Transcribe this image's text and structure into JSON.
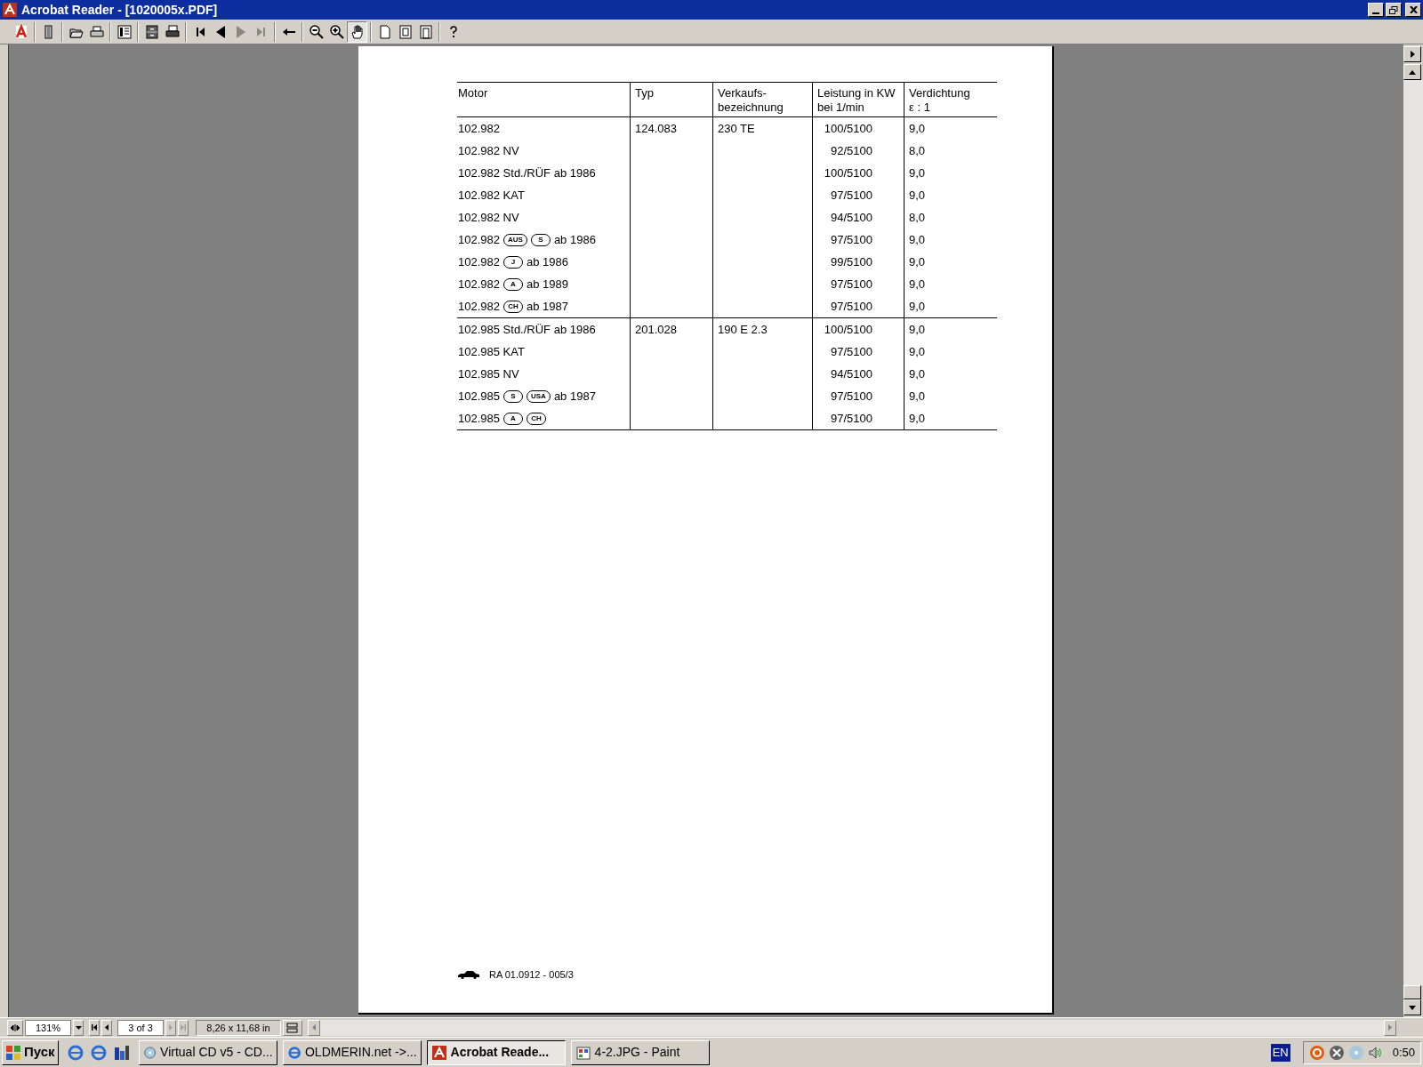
{
  "window": {
    "title": "Acrobat Reader - [1020005x.PDF]"
  },
  "toolbar": [
    {
      "kind": "acrobat",
      "selected": false,
      "disabled": false
    },
    {
      "kind": "sep"
    },
    {
      "kind": "pane",
      "selected": false,
      "disabled": false
    },
    {
      "kind": "sep"
    },
    {
      "kind": "open",
      "selected": false,
      "disabled": false
    },
    {
      "kind": "print",
      "selected": false,
      "disabled": false
    },
    {
      "kind": "sep"
    },
    {
      "kind": "thumbs",
      "selected": false,
      "disabled": false
    },
    {
      "kind": "sep"
    },
    {
      "kind": "cabinet",
      "selected": false,
      "disabled": false
    },
    {
      "kind": "printer2",
      "selected": false,
      "disabled": false
    },
    {
      "kind": "sep"
    },
    {
      "kind": "first",
      "selected": false,
      "disabled": false
    },
    {
      "kind": "prev",
      "selected": false,
      "disabled": false
    },
    {
      "kind": "next",
      "selected": false,
      "disabled": true
    },
    {
      "kind": "last",
      "selected": false,
      "disabled": true
    },
    {
      "kind": "sep"
    },
    {
      "kind": "back",
      "selected": false,
      "disabled": false
    },
    {
      "kind": "sep"
    },
    {
      "kind": "zoomout",
      "selected": false,
      "disabled": false
    },
    {
      "kind": "zoomin",
      "selected": false,
      "disabled": false
    },
    {
      "kind": "hand",
      "selected": true,
      "disabled": false
    },
    {
      "kind": "sep"
    },
    {
      "kind": "page1",
      "selected": false,
      "disabled": false
    },
    {
      "kind": "page2",
      "selected": false,
      "disabled": false
    },
    {
      "kind": "page3",
      "selected": false,
      "disabled": false
    },
    {
      "kind": "sep"
    },
    {
      "kind": "help",
      "selected": false,
      "disabled": false
    }
  ],
  "table": {
    "columns": [
      [
        "Motor"
      ],
      [
        "Typ"
      ],
      [
        "Verkaufs-",
        "bezeichnung"
      ],
      [
        "Leistung in KW",
        "bei 1/min"
      ],
      [
        "Verdichtung",
        "ε : 1"
      ]
    ],
    "groups": [
      {
        "typ": "124.083",
        "name": "230 TE",
        "rows": [
          {
            "motor": [
              {
                "kind": "text",
                "text": "102.982"
              }
            ],
            "power": "100/5100",
            "ratio": "9,0"
          },
          {
            "motor": [
              {
                "kind": "text",
                "text": "102.982 NV"
              }
            ],
            "power": "92/5100",
            "ratio": "8,0"
          },
          {
            "motor": [
              {
                "kind": "text",
                "text": "102.982 Std./RÜF ab 1986"
              }
            ],
            "power": "100/5100",
            "ratio": "9,0"
          },
          {
            "motor": [
              {
                "kind": "text",
                "text": "102.982 KAT"
              }
            ],
            "power": "97/5100",
            "ratio": "9,0"
          },
          {
            "motor": [
              {
                "kind": "text",
                "text": "102.982 NV"
              }
            ],
            "power": "94/5100",
            "ratio": "8,0"
          },
          {
            "motor": [
              {
                "kind": "text",
                "text": "102.982"
              },
              {
                "kind": "badge",
                "text": "AUS"
              },
              {
                "kind": "badge",
                "text": "S"
              },
              {
                "kind": "text",
                "text": "ab 1986"
              }
            ],
            "power": "97/5100",
            "ratio": "9,0"
          },
          {
            "motor": [
              {
                "kind": "text",
                "text": "102.982"
              },
              {
                "kind": "badge",
                "text": "J"
              },
              {
                "kind": "text",
                "text": "ab 1986"
              }
            ],
            "power": "99/5100",
            "ratio": "9,0"
          },
          {
            "motor": [
              {
                "kind": "text",
                "text": "102.982"
              },
              {
                "kind": "badge",
                "text": "A"
              },
              {
                "kind": "text",
                "text": "ab 1989"
              }
            ],
            "power": "97/5100",
            "ratio": "9,0"
          },
          {
            "motor": [
              {
                "kind": "text",
                "text": "102.982"
              },
              {
                "kind": "badge",
                "text": "CH"
              },
              {
                "kind": "text",
                "text": "ab 1987"
              }
            ],
            "power": "97/5100",
            "ratio": "9,0"
          }
        ]
      },
      {
        "typ": "201.028",
        "name": "190 E 2.3",
        "rows": [
          {
            "motor": [
              {
                "kind": "text",
                "text": "102.985 Std./RÜF ab 1986"
              }
            ],
            "power": "100/5100",
            "ratio": "9,0"
          },
          {
            "motor": [
              {
                "kind": "text",
                "text": "102.985 KAT"
              }
            ],
            "power": "97/5100",
            "ratio": "9,0"
          },
          {
            "motor": [
              {
                "kind": "text",
                "text": "102.985 NV"
              }
            ],
            "power": "94/5100",
            "ratio": "9,0"
          },
          {
            "motor": [
              {
                "kind": "text",
                "text": "102.985"
              },
              {
                "kind": "badge",
                "text": "S"
              },
              {
                "kind": "badge",
                "text": "USA"
              },
              {
                "kind": "text",
                "text": "ab 1987"
              }
            ],
            "power": "97/5100",
            "ratio": "9,0"
          },
          {
            "motor": [
              {
                "kind": "text",
                "text": "102.985"
              },
              {
                "kind": "badge",
                "text": "A"
              },
              {
                "kind": "badge",
                "text": "CH"
              }
            ],
            "power": "97/5100",
            "ratio": "9,0"
          }
        ]
      }
    ]
  },
  "footer": {
    "text": "RA 01.0912 - 005/3"
  },
  "status_bar": {
    "zoom": "131%",
    "page": "3 of 3",
    "page_size": "8,26 x 11,68 in"
  },
  "taskbar": {
    "start": "Пуск",
    "tasks": [
      {
        "label": "Virtual CD v5 - CD...",
        "kind": "disc",
        "selected": false
      },
      {
        "label": "OLDMERIN.net ->...",
        "kind": "browser",
        "selected": false
      },
      {
        "label": "Acrobat Reade...",
        "kind": "acrobat",
        "selected": true
      },
      {
        "label": "4-2.JPG - Paint",
        "kind": "paint",
        "selected": false
      }
    ],
    "language": "EN",
    "clock": "0:50"
  }
}
